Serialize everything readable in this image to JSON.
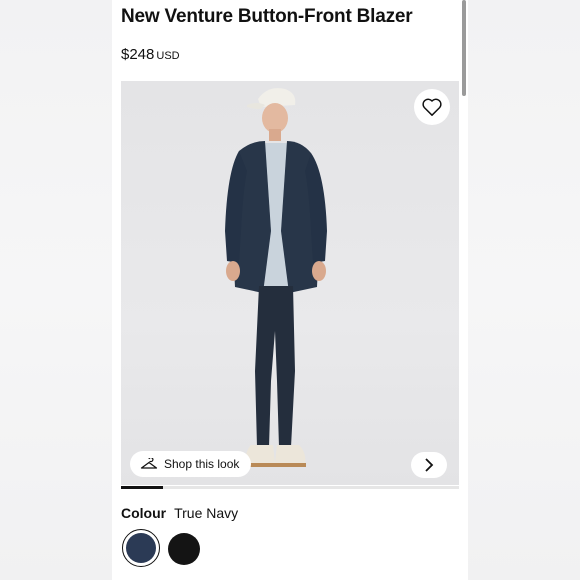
{
  "product": {
    "title": "New Venture Button-Front Blazer",
    "price": "$248",
    "currency": "USD"
  },
  "gallery": {
    "shop_look_label": "Shop this look",
    "wishlist_icon": "heart-outline-icon",
    "shop_look_icon": "hanger-icon",
    "next_icon": "chevron-right-icon",
    "progress": 0.125
  },
  "colour": {
    "label": "Colour",
    "selected": "True Navy",
    "swatches": [
      {
        "name": "True Navy",
        "color": "#2b3a55",
        "selected": true
      },
      {
        "name": "Black",
        "color": "#141414",
        "selected": false
      }
    ]
  }
}
